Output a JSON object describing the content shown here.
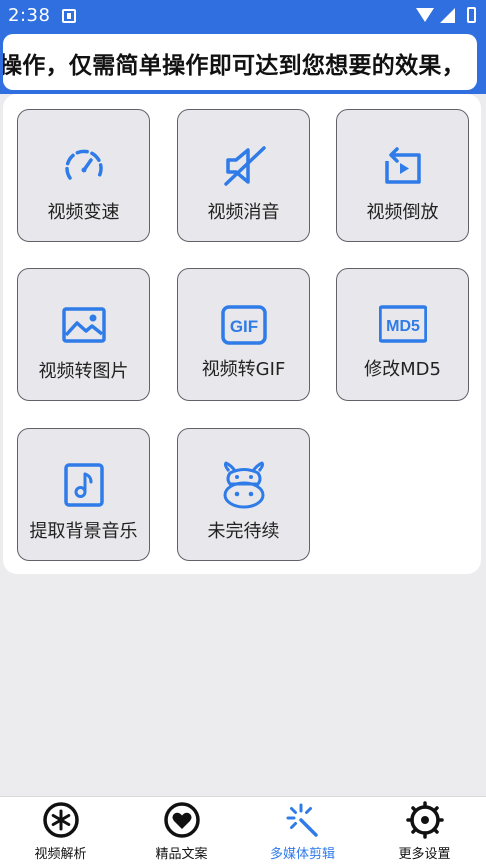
{
  "status_bar": {
    "time": "2:38"
  },
  "marquee": {
    "text": "操作，仅需简单操作即可达到您想要的效果，"
  },
  "tiles": [
    {
      "label": "视频变速"
    },
    {
      "label": "视频消音"
    },
    {
      "label": "视频倒放"
    },
    {
      "label": "视频转图片"
    },
    {
      "label": "视频转GIF",
      "icon_text": "GIF"
    },
    {
      "label": "修改MD5",
      "icon_text": "MD5"
    },
    {
      "label": "提取背景音乐"
    },
    {
      "label": "未完待续"
    }
  ],
  "bottom_nav": {
    "items": [
      {
        "label": "视频解析"
      },
      {
        "label": "精品文案"
      },
      {
        "label": "多媒体剪辑"
      },
      {
        "label": "更多设置"
      }
    ],
    "active_index": 2
  },
  "colors": {
    "accent": "#2f7be8",
    "status_bar": "#2f6fe0",
    "background": "#ececef",
    "tile_bg": "#e8e8ec"
  }
}
